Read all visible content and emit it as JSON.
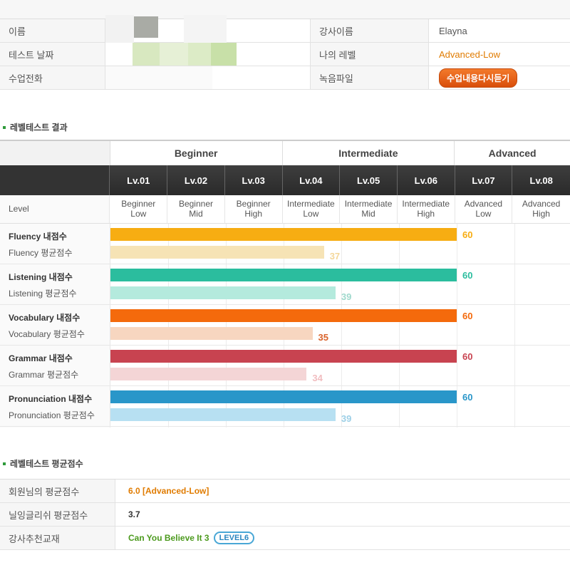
{
  "info": {
    "name_label": "이름",
    "test_date_label": "테스트 날짜",
    "class_phone_label": "수업전화",
    "teacher_label": "강사이름",
    "teacher_value": "Elayna",
    "my_level_label": "나의 레벨",
    "my_level_value": "Advanced-Low",
    "recording_label": "녹음파일",
    "replay_button": "수업내용다시듣기"
  },
  "section1_title": "레벨테스트 결과",
  "bands": [
    "Beginner",
    "Intermediate",
    "Advanced"
  ],
  "levels": [
    "Lv.01",
    "Lv.02",
    "Lv.03",
    "Lv.04",
    "Lv.05",
    "Lv.06",
    "Lv.07",
    "Lv.08"
  ],
  "level_row_label": "Level",
  "sublevels": [
    [
      "Beginner",
      "Low"
    ],
    [
      "Beginner",
      "Mid"
    ],
    [
      "Beginner",
      "High"
    ],
    [
      "Intermediate",
      "Low"
    ],
    [
      "Intermediate",
      "Mid"
    ],
    [
      "Intermediate",
      "High"
    ],
    [
      "Advanced",
      "Low"
    ],
    [
      "Advanced",
      "High"
    ]
  ],
  "chart_data": {
    "type": "bar",
    "x_max": 80,
    "categories": [
      "Fluency",
      "Listening",
      "Vocabulary",
      "Grammar",
      "Pronunciation"
    ],
    "series": [
      {
        "name": "내점수",
        "values": [
          60,
          60,
          60,
          60,
          60
        ]
      },
      {
        "name": "평균점수",
        "values": [
          37,
          39,
          35,
          34,
          39
        ]
      }
    ],
    "labels": [
      {
        "my": "Fluency 내점수",
        "avg": "Fluency 평균점수",
        "color": "#f7ad12",
        "light": "#f6e3b5",
        "avgtext": "#f4d79a"
      },
      {
        "my": "Listening 내점수",
        "avg": "Listening 평균점수",
        "color": "#2bbd9e",
        "light": "#b4eadd",
        "avgtext": "#9fd9cc"
      },
      {
        "my": "Vocabulary 내점수",
        "avg": "Vocabulary 평균점수",
        "color": "#f46a0c",
        "light": "#f7d6c0",
        "avgtext": "#d9622a"
      },
      {
        "my": "Grammar 내점수",
        "avg": "Grammar 평균점수",
        "color": "#c84350",
        "light": "#f4d5d6",
        "avgtext": "#f1bdc0"
      },
      {
        "my": "Pronunciation 내점수",
        "avg": "Pronunciation 평균점수",
        "color": "#2996c9",
        "light": "#b7e0f2",
        "avgtext": "#9ccfe6"
      }
    ]
  },
  "section2_title": "레벨테스트 평균점수",
  "avg": {
    "member_avg_label": "회원님의 평균점수",
    "member_avg_value": "6.0 [Advanced-Low]",
    "nilling_avg_label": "닐잉글리쉬 평균점수",
    "nilling_avg_value": "3.7",
    "textbook_label": "강사추천교재",
    "textbook_value": "Can You Believe It 3",
    "textbook_badge": "LEVEL6"
  }
}
